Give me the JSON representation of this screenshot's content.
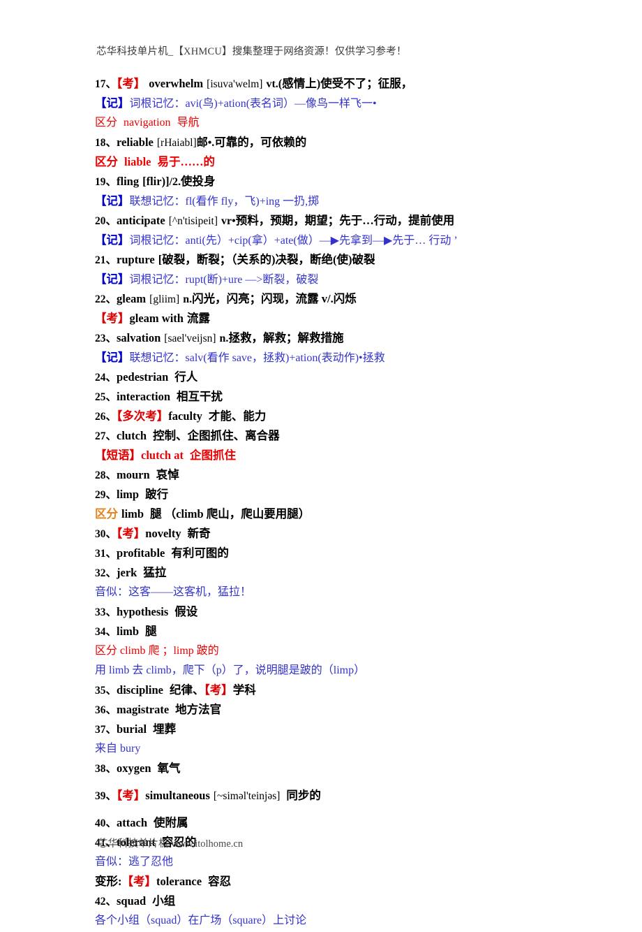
{
  "document": {
    "header": "芯华科技单片机_【XHMCU】搜集整理于网络资源！仅供学习参考！",
    "footer": "芯华科技单片机 www.itolhome.cn",
    "colors": {
      "text": "#000000",
      "blue": "#3333cc",
      "tag_blue": "#0000cc",
      "red": "#ee0000",
      "orange": "#e8801a",
      "header_gray": "#3b3b3b"
    }
  },
  "entries": {
    "e17": {
      "num": "17、",
      "tag": "【考】",
      "word": "overwhelm",
      "phonetic": "[isuva'welm]",
      "pos": "vt.",
      "gloss": "(感情上)使受不了；征服，"
    },
    "e17_note": {
      "tag": "【记】",
      "text": "词根记忆：avi(鸟)+ation(表名词）—像鸟一样飞一•"
    },
    "e17_note2": {
      "label": "区分",
      "word": "navigation",
      "gloss": "导航"
    },
    "e18": {
      "num": "18、",
      "word": "reliable",
      "phonetic": "[rHaiabl]",
      "pos": "邮•.",
      "gloss": "可靠的，可依赖的"
    },
    "e18_note": {
      "label": "区分",
      "word": "liable",
      "gloss": "易于……的"
    },
    "e19": {
      "num": "19、",
      "word": "fling",
      "phonetic": "[flir)]",
      "pos": "/2.",
      "gloss": "使投身"
    },
    "e19_note": {
      "tag": "【记】",
      "text": "联想记忆：fl(看作 fly，飞)+ing 一扔,掷"
    },
    "e20": {
      "num": "20、",
      "word": "anticipate",
      "phonetic": "[^n'tisipeit]",
      "pos": "vr•",
      "gloss": "预料，预期，期望；先于…行动，提前使用"
    },
    "e20_note": {
      "tag": "【记】",
      "text": "词根记忆：anti(先）+cip(拿）+ate(做）—▶先拿到—▶先于… 行动 ’"
    },
    "e21": {
      "num": "21、",
      "word": "rupture",
      "gloss": "[破裂，断裂；（关系的)决裂，断绝(使)破裂"
    },
    "e21_note": {
      "tag": "【记】",
      "text": "词根记忆：rupt(断)+ure —>断裂，破裂"
    },
    "e22": {
      "num": "22、",
      "word": "gleam",
      "phonetic": "[gliim]",
      "pos": "n.",
      "gloss": "闪光，闪亮；闪现，流露 v/.闪烁"
    },
    "e22_note": {
      "tag": "【考】",
      "word": "gleam with",
      "gloss": "流露"
    },
    "e23": {
      "num": "23、",
      "word": "salvation",
      "phonetic": "[sael'veijsn]",
      "pos": "n.",
      "gloss": "拯救，解救；解救措施"
    },
    "e23_note": {
      "tag": "【记】",
      "text": "联想记忆：salv(看作 save，拯救)+ation(表动作)•拯救"
    },
    "e24": {
      "num": "24、",
      "word": "pedestrian",
      "gloss": "行人"
    },
    "e25": {
      "num": "25、",
      "word": "interaction",
      "gloss": "相互干扰"
    },
    "e26": {
      "num": "26、",
      "tag": "【多次考】",
      "word": "faculty",
      "gloss": "才能、能力"
    },
    "e27": {
      "num": "27、",
      "word": "clutch",
      "gloss": "控制、企图抓住、离合器"
    },
    "e27_note": {
      "tag": "【短语】",
      "word": "clutch at",
      "gloss": "企图抓住"
    },
    "e28": {
      "num": "28、",
      "word": "mourn",
      "gloss": "哀悼"
    },
    "e29": {
      "num": "29、",
      "word": "limp",
      "gloss": "跛行"
    },
    "e29_note": {
      "label": "区分",
      "word": "limb",
      "gloss": "腿 （climb 爬山，爬山要用腿）"
    },
    "e30": {
      "num": "30、",
      "tag": "【考】",
      "word": "novelty",
      "gloss": "新奇"
    },
    "e31": {
      "num": "31、",
      "word": "profitable",
      "gloss": "有利可图的"
    },
    "e32": {
      "num": "32、",
      "word": "jerk",
      "gloss": "猛拉"
    },
    "e32_note": {
      "text": "音似：这客——这客机，猛拉！"
    },
    "e33": {
      "num": "33、",
      "word": "hypothesis",
      "gloss": "假设"
    },
    "e34": {
      "num": "34、",
      "word": "limb",
      "gloss": "腿"
    },
    "e34_note1": {
      "text": "区分 climb 爬 ；limp 跛的"
    },
    "e34_note2": {
      "text": "用 limb 去 climb，爬下（p）了，说明腿是跛的（limp）"
    },
    "e35": {
      "num": "35、",
      "word": "discipline",
      "gloss_before": "纪律、",
      "tag": "【考】",
      "gloss_after": "学科"
    },
    "e36": {
      "num": "36、",
      "word": "magistrate",
      "gloss": "地方法官"
    },
    "e37": {
      "num": "37、",
      "word": "burial",
      "gloss": "埋葬"
    },
    "e37_note": {
      "text": "来自 bury"
    },
    "e38": {
      "num": "38、",
      "word": "oxygen",
      "gloss": "氧气"
    },
    "e39": {
      "num": "39、",
      "tag": "【考】",
      "word": "simultaneous",
      "phonetic": "[~siməl'teinjəs]",
      "gloss": "同步的"
    },
    "e40": {
      "num": "40、",
      "word": "attach",
      "gloss": "使附属"
    },
    "e41": {
      "num": "41、",
      "word": "tolerant",
      "gloss": "容忍的"
    },
    "e41_note1": {
      "text": "音似：逃了忍他"
    },
    "e41_note2": {
      "label": "变形:",
      "tag": "【考】",
      "word": "tolerance",
      "gloss": "容忍"
    },
    "e42": {
      "num": "42、",
      "word": "squad",
      "gloss": "小组"
    },
    "e42_note": {
      "text": "各个小组（squad）在广场（square）上讨论"
    }
  }
}
